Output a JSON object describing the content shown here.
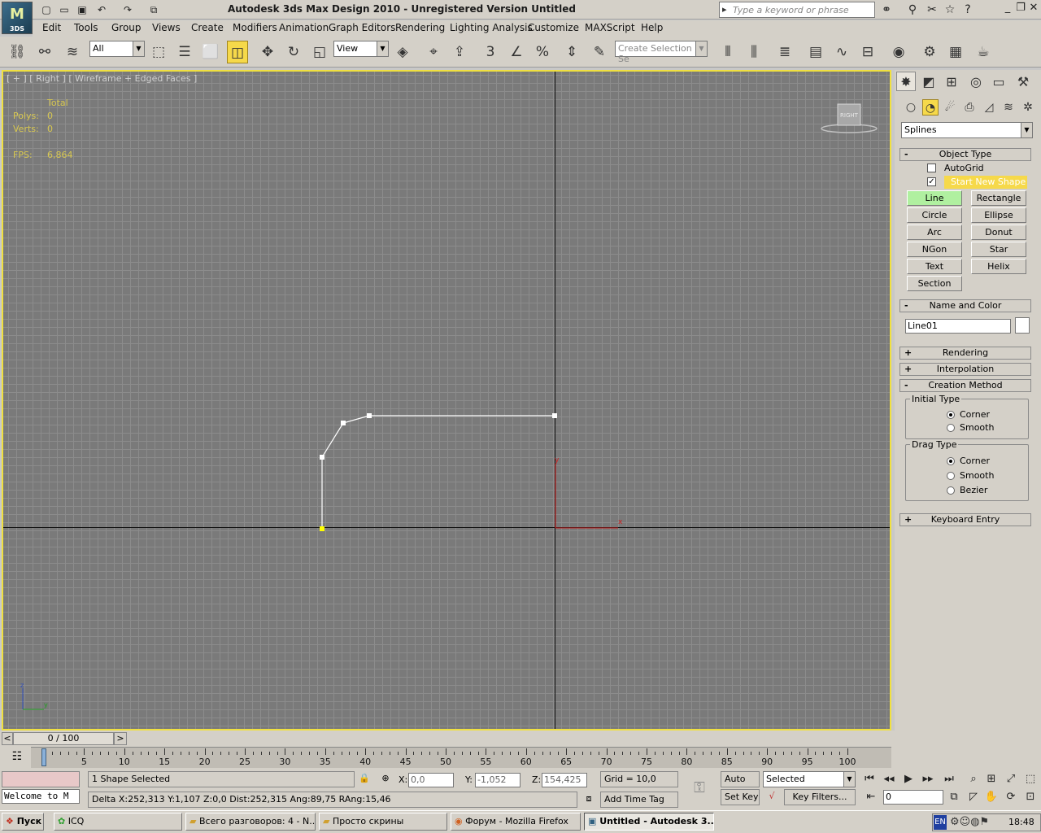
{
  "app": {
    "title": "Autodesk 3ds Max Design 2010  - Unregistered Version    Untitled",
    "logo_letter": "M",
    "logo_sub": "3DS",
    "search_placeholder": "Type a keyword or phrase"
  },
  "menus": [
    "Edit",
    "Tools",
    "Group",
    "Views",
    "Create",
    "Modifiers",
    "Animation",
    "Graph Editors",
    "Rendering",
    "Lighting Analysis",
    "Customize",
    "MAXScript",
    "Help"
  ],
  "toolbar": {
    "selection_filter": "All",
    "ref_coord": "View",
    "selection_set_placeholder": "Create Selection Se",
    "snap_angle_label": "3"
  },
  "viewport": {
    "label": "[ + ] [ Right ] [ Wireframe + Edged Faces ]",
    "stats": {
      "total_label": "Total",
      "polys_label": "Polys:",
      "polys": "0",
      "verts_label": "Verts:",
      "verts": "0",
      "fps_label": "FPS:",
      "fps": "6,864"
    },
    "viewcube_label": "RIGHT",
    "gizmo_x": "x",
    "gizmo_y": "y",
    "axis_tripod_z": "z",
    "axis_tripod_y": "y",
    "colors": {
      "border": "#f0e040",
      "grid": "#8c8c8c",
      "background": "#7a7a7a",
      "spline": "#ffffff",
      "first_vertex": "#ffff00",
      "gizmo": "#cc2020"
    }
  },
  "command_panel": {
    "category": "Splines",
    "object_type": {
      "title": "Object Type",
      "autogrid_label": "AutoGrid",
      "autogrid_checked": false,
      "start_new_shape_label": "Start New Shape",
      "start_new_shape_checked": true,
      "buttons": [
        "Line",
        "Rectangle",
        "Circle",
        "Ellipse",
        "Arc",
        "Donut",
        "NGon",
        "Star",
        "Text",
        "Helix",
        "Section"
      ],
      "active_button": "Line"
    },
    "name_color": {
      "title": "Name and Color",
      "name": "Line01"
    },
    "rendering_title": "Rendering",
    "interpolation_title": "Interpolation",
    "creation_method": {
      "title": "Creation Method",
      "initial_type_label": "Initial Type",
      "initial_options": [
        "Corner",
        "Smooth"
      ],
      "initial_selected": "Corner",
      "drag_type_label": "Drag Type",
      "drag_options": [
        "Corner",
        "Smooth",
        "Bezier"
      ],
      "drag_selected": "Corner"
    },
    "keyboard_entry_title": "Keyboard Entry",
    "plus": "+",
    "minus": "-"
  },
  "timeline": {
    "slider_label": "0 / 100",
    "ticks": [
      "0",
      "5",
      "10",
      "15",
      "20",
      "25",
      "30",
      "35",
      "40",
      "45",
      "50",
      "55",
      "60",
      "65",
      "70",
      "75",
      "80",
      "85",
      "90",
      "95",
      "100"
    ],
    "prev": "<",
    "next": ">"
  },
  "status": {
    "selection": "1 Shape Selected",
    "prompt": "Delta X:252,313  Y:1,107  Z:0,0  Dist:252,315 Ang:89,75 RAng:15,46",
    "x_label": "X:",
    "x": "0,0",
    "y_label": "Y:",
    "y": "-1,052",
    "z_label": "Z:",
    "z": "154,425",
    "grid": "Grid = 10,0",
    "add_time_tag": "Add Time Tag",
    "listener": "Welcome to M",
    "auto_key": "Auto Key",
    "set_key": "Set Key",
    "key_mode": "Selected",
    "key_filters": "Key Filters...",
    "frame": "0"
  },
  "taskbar": {
    "start": "Пуск",
    "tasks": [
      "ICQ",
      "Всего разговоров: 4 - N...",
      "Просто скрины",
      "Форум - Mozilla Firefox",
      "Untitled - Autodesk 3..."
    ],
    "lang": "EN",
    "clock": "18:48"
  }
}
